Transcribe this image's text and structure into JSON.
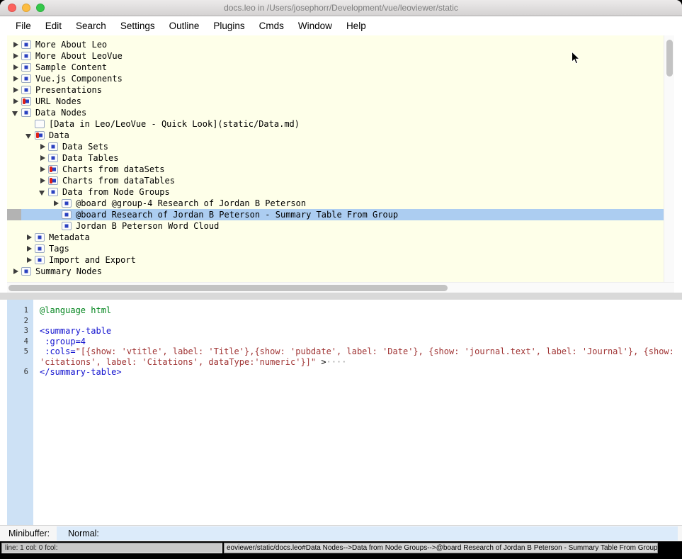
{
  "window": {
    "title": "docs.leo in /Users/josephorr/Development/vue/leoviewer/static"
  },
  "menu": {
    "items": [
      "File",
      "Edit",
      "Search",
      "Settings",
      "Outline",
      "Plugins",
      "Cmds",
      "Window",
      "Help"
    ]
  },
  "tree": {
    "items": [
      {
        "label": "More About Leo",
        "level": 0,
        "arrow": "right",
        "icon": "dot",
        "selected": false
      },
      {
        "label": "More About LeoVue",
        "level": 0,
        "arrow": "right",
        "icon": "dot",
        "selected": false
      },
      {
        "label": "Sample Content",
        "level": 0,
        "arrow": "right",
        "icon": "dot",
        "selected": false
      },
      {
        "label": "Vue.js Components",
        "level": 0,
        "arrow": "right",
        "icon": "dot",
        "selected": false
      },
      {
        "label": "Presentations",
        "level": 0,
        "arrow": "right",
        "icon": "dot",
        "selected": false
      },
      {
        "label": "URL Nodes",
        "level": 0,
        "arrow": "right",
        "icon": "dot-dirty",
        "selected": false
      },
      {
        "label": "Data Nodes",
        "level": 0,
        "arrow": "down",
        "icon": "dot",
        "selected": false
      },
      {
        "label": "[Data in Leo/LeoVue - Quick Look](static/Data.md)",
        "level": 1,
        "arrow": "none",
        "icon": "plain",
        "selected": false
      },
      {
        "label": "Data",
        "level": 1,
        "arrow": "down",
        "icon": "dot-dirty",
        "selected": false
      },
      {
        "label": "Data Sets",
        "level": 2,
        "arrow": "right",
        "icon": "dot",
        "selected": false
      },
      {
        "label": "Data Tables",
        "level": 2,
        "arrow": "right",
        "icon": "dot",
        "selected": false
      },
      {
        "label": "Charts from dataSets",
        "level": 2,
        "arrow": "right",
        "icon": "dot-dirty",
        "selected": false
      },
      {
        "label": "Charts from dataTables",
        "level": 2,
        "arrow": "right",
        "icon": "dot-dirty",
        "selected": false
      },
      {
        "label": "Data from Node Groups",
        "level": 2,
        "arrow": "down",
        "icon": "dot",
        "selected": false
      },
      {
        "label": "@board @group-4 Research of Jordan B Peterson",
        "level": 3,
        "arrow": "right",
        "icon": "dot",
        "selected": false
      },
      {
        "label": "@board Research of Jordan B Peterson - Summary Table From Group",
        "level": 3,
        "arrow": "none",
        "icon": "dot",
        "selected": true
      },
      {
        "label": "Jordan B Peterson Word Cloud",
        "level": 3,
        "arrow": "none",
        "icon": "dot",
        "selected": false
      },
      {
        "label": "Metadata",
        "level": 1,
        "arrow": "right",
        "icon": "dot",
        "selected": false
      },
      {
        "label": "Tags",
        "level": 1,
        "arrow": "right",
        "icon": "dot",
        "selected": false
      },
      {
        "label": "Import and Export",
        "level": 1,
        "arrow": "right",
        "icon": "dot",
        "selected": false
      },
      {
        "label": "Summary Nodes",
        "level": 0,
        "arrow": "right",
        "icon": "dot",
        "selected": false
      }
    ]
  },
  "body": {
    "lines": [
      {
        "num": "1",
        "segments": [
          {
            "text": "@language html",
            "color": "green"
          }
        ]
      },
      {
        "num": "2",
        "segments": []
      },
      {
        "num": "3",
        "segments": [
          {
            "text": "<summary-table",
            "color": "blue"
          }
        ]
      },
      {
        "num": "4",
        "segments": [
          {
            "text": " :group=4",
            "color": "blue"
          }
        ]
      },
      {
        "num": "5",
        "segments": [
          {
            "text": " :cols=",
            "color": "blue"
          },
          {
            "text": "\"[{show: 'vtitle', label: 'Title'},{show: 'pubdate', label: 'Date'}, {show: 'journal.text', label: 'Journal'}, {show: 'citations', label: 'Citations', dataType:'numeric'}]\"",
            "color": "red"
          },
          {
            "text": " >",
            "color": "black"
          },
          {
            "text": "····",
            "color": "gray"
          }
        ]
      },
      {
        "num": "6",
        "segments": [
          {
            "text": "</summary-table>",
            "color": "blue"
          }
        ]
      }
    ]
  },
  "minibuffer": {
    "label": "Minibuffer:",
    "value": "Normal:"
  },
  "status": {
    "left": "line: 1 col: 0 fcol:",
    "right": "eoviewer/static/docs.leo#Data Nodes-->Data from Node Groups-->@board Research of Jordan B Peterson - Summary Table From Group"
  }
}
